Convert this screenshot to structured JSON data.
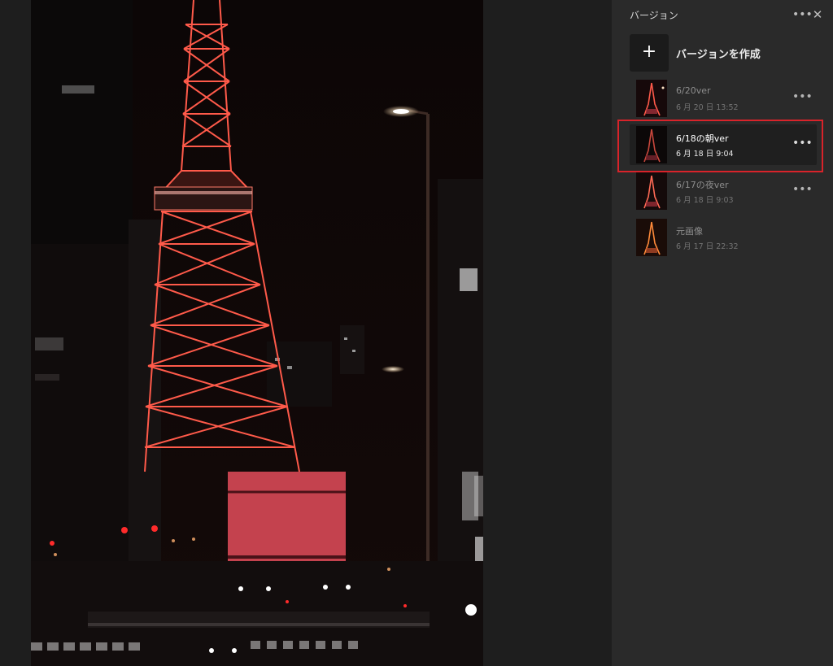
{
  "panel": {
    "title": "バージョン",
    "more_icon": "more-horizontal-icon",
    "close_icon": "close-icon",
    "create_label": "バージョンを作成",
    "create_icon": "plus-icon",
    "versions": [
      {
        "name": "6/20ver",
        "date": "6 月 20 日 13:52",
        "selected": false,
        "has_menu": true
      },
      {
        "name": "6/18の朝ver",
        "date": "6 月 18 日 9:04",
        "selected": true,
        "has_menu": true
      },
      {
        "name": "6/17の夜ver",
        "date": "6 月 18 日 9:03",
        "selected": false,
        "has_menu": true
      },
      {
        "name": "元画像",
        "date": "6 月 17 日 22:32",
        "selected": false,
        "has_menu": false
      }
    ]
  },
  "colors": {
    "panel_bg": "#2a2a2a",
    "canvas_bg": "#1e1e1e",
    "highlight": "#d8232a",
    "tower": "#ff5a4a"
  }
}
